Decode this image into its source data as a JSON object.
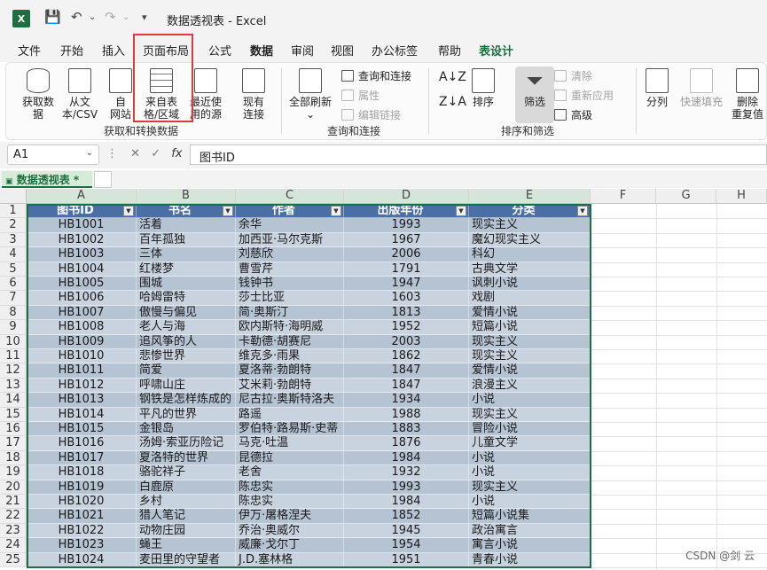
{
  "window": {
    "title": "数据透视表 - Excel"
  },
  "ribbon_tabs": [
    "文件",
    "开始",
    "插入",
    "页面布局",
    "公式",
    "数据",
    "审阅",
    "视图",
    "办公标签",
    "帮助",
    "表设计"
  ],
  "ribbon": {
    "get_data": "获取数\n据",
    "from_text_csv": "从文\n本/CSV",
    "from_web": "自\n网站",
    "from_table_range": "来自表\n格/区域",
    "recent_sources": "最近使\n用的源",
    "existing_connections": "现有\n连接",
    "group_get_transform": "获取和转换数据",
    "refresh_all": "全部刷新",
    "queries_connections": "查询和连接",
    "properties": "属性",
    "edit_links": "编辑链接",
    "group_queries": "查询和连接",
    "sort": "排序",
    "filter": "筛选",
    "clear": "清除",
    "reapply": "重新应用",
    "advanced": "高级",
    "group_sort_filter": "排序和筛选",
    "split": "分列",
    "flash_fill": "快速填充",
    "remove_duplicates": "删除\n重复值"
  },
  "formula_bar": {
    "name_box": "A1",
    "fx": "fx",
    "content": "图书ID"
  },
  "sheet_tab": {
    "name": "数据透视表 *"
  },
  "columns": [
    "A",
    "B",
    "C",
    "D",
    "E",
    "F",
    "G",
    "H"
  ],
  "table": {
    "headers": [
      "图书ID",
      "书名",
      "作者",
      "出版年份",
      "分类"
    ],
    "rows": [
      [
        "HB1001",
        "活着",
        "余华",
        "1993",
        "现实主义"
      ],
      [
        "HB1002",
        "百年孤独",
        "加西亚·马尔克斯",
        "1967",
        "魔幻现实主义"
      ],
      [
        "HB1003",
        "三体",
        "刘慈欣",
        "2006",
        "科幻"
      ],
      [
        "HB1004",
        "红楼梦",
        "曹雪芹",
        "1791",
        "古典文学"
      ],
      [
        "HB1005",
        "围城",
        "钱钟书",
        "1947",
        "讽刺小说"
      ],
      [
        "HB1006",
        "哈姆雷特",
        "莎士比亚",
        "1603",
        "戏剧"
      ],
      [
        "HB1007",
        "傲慢与偏见",
        "简·奥斯汀",
        "1813",
        "爱情小说"
      ],
      [
        "HB1008",
        "老人与海",
        "欧内斯特·海明威",
        "1952",
        "短篇小说"
      ],
      [
        "HB1009",
        "追风筝的人",
        "卡勒德·胡赛尼",
        "2003",
        "现实主义"
      ],
      [
        "HB1010",
        "悲惨世界",
        "维克多·雨果",
        "1862",
        "现实主义"
      ],
      [
        "HB1011",
        "简爱",
        "夏洛蒂·勃朗特",
        "1847",
        "爱情小说"
      ],
      [
        "HB1012",
        "呼啸山庄",
        "艾米莉·勃朗特",
        "1847",
        "浪漫主义"
      ],
      [
        "HB1013",
        "钢铁是怎样炼成的",
        "尼古拉·奥斯特洛夫",
        "1934",
        "小说"
      ],
      [
        "HB1014",
        "平凡的世界",
        "路遥",
        "1988",
        "现实主义"
      ],
      [
        "HB1015",
        "金银岛",
        "罗伯特·路易斯·史蒂",
        "1883",
        "冒险小说"
      ],
      [
        "HB1016",
        "汤姆·索亚历险记",
        "马克·吐温",
        "1876",
        "儿童文学"
      ],
      [
        "HB1017",
        "夏洛特的世界",
        "昆德拉",
        "1984",
        "小说"
      ],
      [
        "HB1018",
        "骆驼祥子",
        "老舍",
        "1932",
        "小说"
      ],
      [
        "HB1019",
        "白鹿原",
        "陈忠实",
        "1993",
        "现实主义"
      ],
      [
        "HB1020",
        "乡村",
        "陈忠实",
        "1984",
        "小说"
      ],
      [
        "HB1021",
        "猎人笔记",
        "伊万·屠格涅夫",
        "1852",
        "短篇小说集"
      ],
      [
        "HB1022",
        "动物庄园",
        "乔治·奥威尔",
        "1945",
        "政治寓言"
      ],
      [
        "HB1023",
        "蝇王",
        "威廉·戈尔丁",
        "1954",
        "寓言小说"
      ],
      [
        "HB1024",
        "麦田里的守望者",
        "J.D.塞林格",
        "1951",
        "青春小说"
      ]
    ]
  },
  "watermark": "CSDN @剑 云",
  "colors": {
    "excel_green": "#1d6f42",
    "table_header": "#4a6fa5",
    "band_odd": "#b5c3d3",
    "band_even": "#c9d3df",
    "highlight_red": "#e03b3b"
  }
}
